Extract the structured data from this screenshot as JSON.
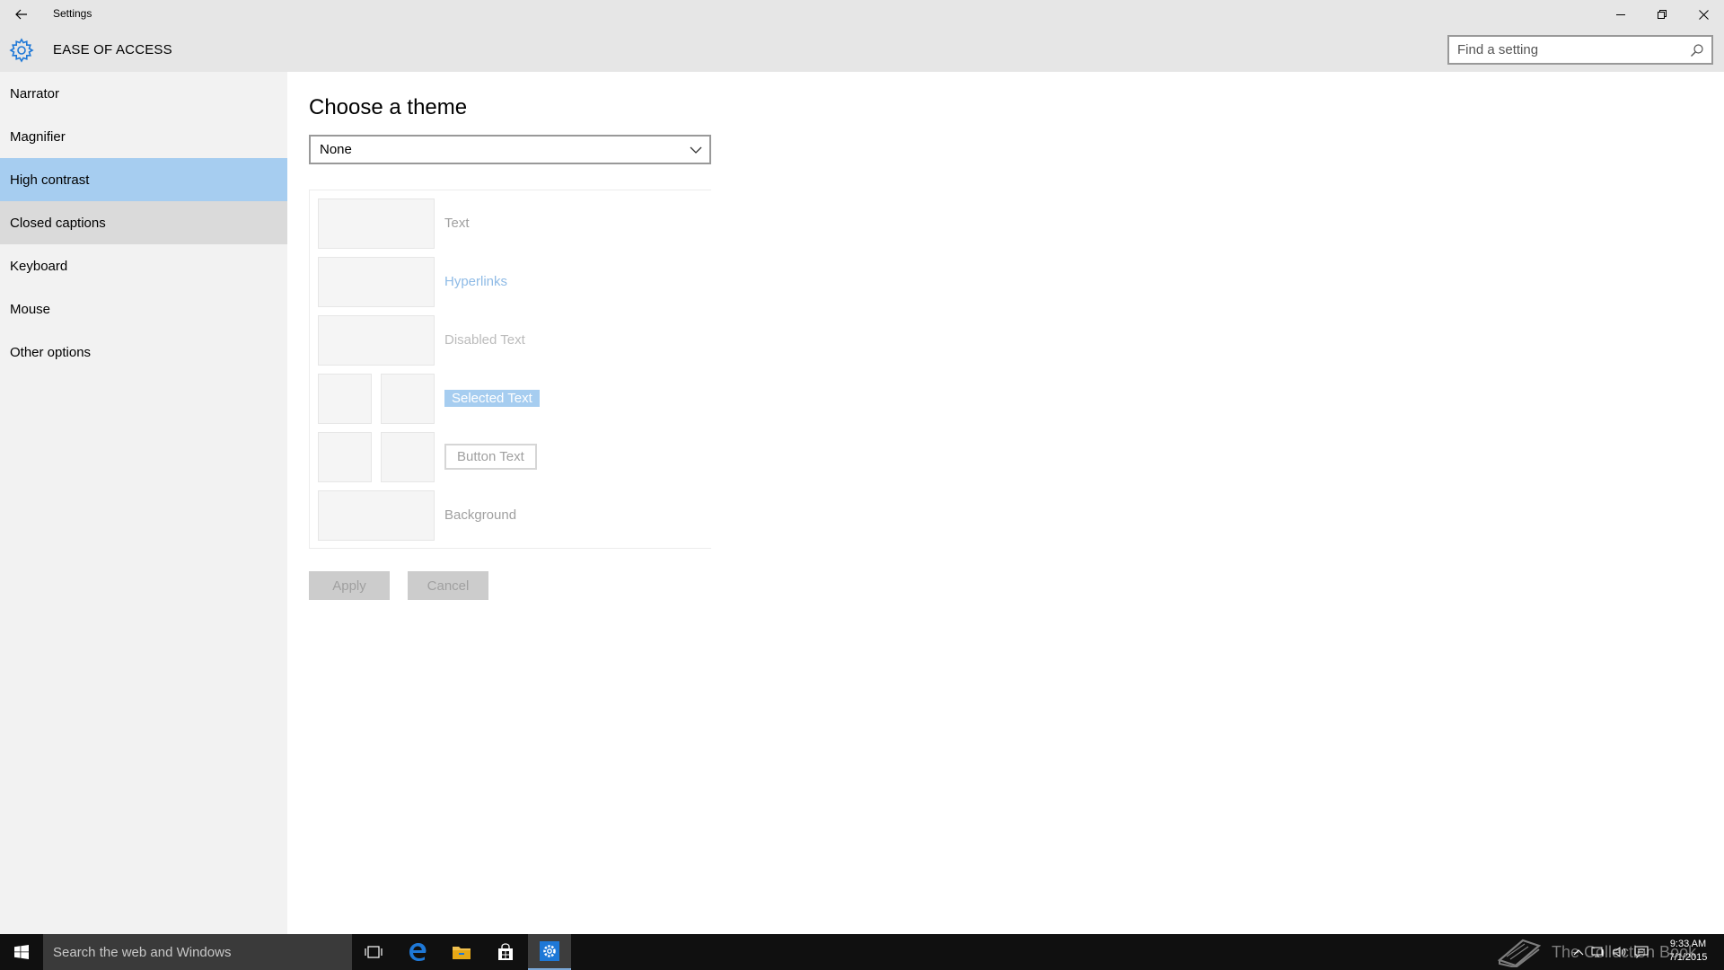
{
  "window": {
    "title": "Settings",
    "controls": [
      "minimize",
      "restore",
      "close"
    ]
  },
  "header": {
    "section_title": "EASE OF ACCESS",
    "search_placeholder": "Find a setting"
  },
  "sidebar": {
    "items": [
      {
        "label": "Narrator",
        "state": "normal"
      },
      {
        "label": "Magnifier",
        "state": "normal"
      },
      {
        "label": "High contrast",
        "state": "selected"
      },
      {
        "label": "Closed captions",
        "state": "hover"
      },
      {
        "label": "Keyboard",
        "state": "normal"
      },
      {
        "label": "Mouse",
        "state": "normal"
      },
      {
        "label": "Other options",
        "state": "normal"
      }
    ]
  },
  "main": {
    "page_title": "Choose a theme",
    "theme_dropdown": {
      "selected": "None"
    },
    "preview": {
      "text": "Text",
      "hyperlinks": "Hyperlinks",
      "disabled_text": "Disabled Text",
      "selected_text": "Selected Text",
      "button_text": "Button Text",
      "background": "Background"
    },
    "apply_label": "Apply",
    "cancel_label": "Cancel"
  },
  "taskbar": {
    "search_placeholder": "Search the web and Windows",
    "watermark": "The Collection Book",
    "clock_time": "9:33 AM",
    "clock_date": "7/1/2015"
  },
  "colors": {
    "chrome": "#e6e6e6",
    "sidebar": "#f2f2f2",
    "accent_selected": "#a6cdf0",
    "taskbar": "#101010",
    "edge_blue": "#1e78d7"
  }
}
